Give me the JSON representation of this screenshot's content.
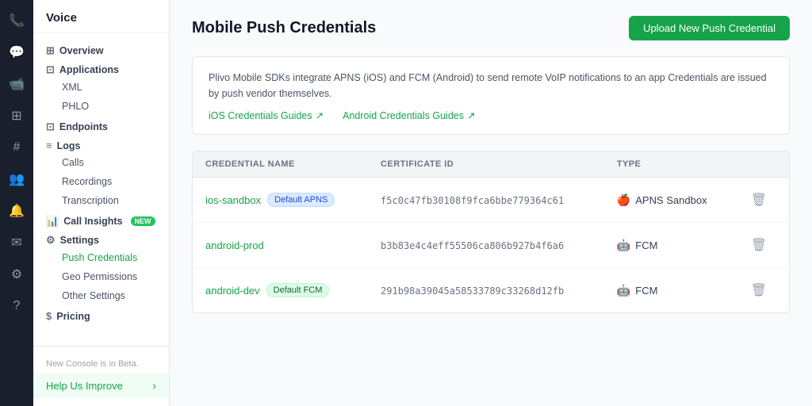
{
  "app": {
    "title": "Voice"
  },
  "icon_rail": {
    "items": [
      {
        "name": "phone-icon",
        "symbol": "📞",
        "active": true
      },
      {
        "name": "message-icon",
        "symbol": "💬",
        "active": false
      },
      {
        "name": "video-icon",
        "symbol": "📹",
        "active": false
      },
      {
        "name": "grid-icon",
        "symbol": "⋮⋮",
        "active": false
      },
      {
        "name": "hash-icon",
        "symbol": "#",
        "active": false
      },
      {
        "name": "users-icon",
        "symbol": "👥",
        "active": false
      },
      {
        "name": "bell-icon",
        "symbol": "🔔",
        "active": false
      },
      {
        "name": "letter-icon",
        "symbol": "✉",
        "active": false
      },
      {
        "name": "settings-icon",
        "symbol": "⚙",
        "active": false
      },
      {
        "name": "help-icon",
        "symbol": "?",
        "active": false
      }
    ]
  },
  "sidebar": {
    "title": "Voice",
    "nav": [
      {
        "group": "Overview",
        "icon": "⊞",
        "children": []
      },
      {
        "group": "Applications",
        "icon": "⊡",
        "children": [
          {
            "label": "XML",
            "active": false
          },
          {
            "label": "PHLO",
            "active": false
          }
        ]
      },
      {
        "group": "Endpoints",
        "icon": "⊡",
        "children": []
      },
      {
        "group": "Logs",
        "icon": "≡",
        "children": [
          {
            "label": "Calls",
            "active": false
          },
          {
            "label": "Recordings",
            "active": false
          },
          {
            "label": "Transcription",
            "active": false
          }
        ]
      },
      {
        "group": "Call Insights",
        "icon": "📊",
        "badge": "NEW",
        "children": []
      },
      {
        "group": "Settings",
        "icon": "⚙",
        "children": [
          {
            "label": "Push Credentials",
            "active": true
          },
          {
            "label": "Geo Permissions",
            "active": false
          },
          {
            "label": "Other Settings",
            "active": false
          }
        ]
      },
      {
        "group": "Pricing",
        "icon": "$",
        "children": []
      }
    ],
    "footer_note": "New Console is in Beta.",
    "help_label": "Help Us Improve"
  },
  "main": {
    "title": "Mobile Push Credentials",
    "upload_button": "Upload New Push Credential",
    "info": {
      "text": "Plivo Mobile SDKs integrate APNS (iOS) and FCM (Android) to send remote VoIP notifications to an app Credentials are issued by push vendor themselves.",
      "links": [
        {
          "label": "iOS Credentials Guides",
          "icon": "↗"
        },
        {
          "label": "Android Credentials Guides",
          "icon": "↗"
        }
      ]
    },
    "table": {
      "headers": [
        {
          "key": "name",
          "label": "Credential NAME"
        },
        {
          "key": "cert_id",
          "label": "Certificate ID"
        },
        {
          "key": "type",
          "label": "TYPE"
        }
      ],
      "rows": [
        {
          "name": "ios-sandbox",
          "badge": "Default APNS",
          "badge_type": "apns",
          "cert_id": "f5c0c47fb30108f9fca6bbe779364c61",
          "type": "APNS Sandbox",
          "type_icon": "🍎"
        },
        {
          "name": "android-prod",
          "badge": "",
          "badge_type": "",
          "cert_id": "b3b83e4c4eff55506ca806b927b4f6a6",
          "type": "FCM",
          "type_icon": "🤖"
        },
        {
          "name": "android-dev",
          "badge": "Default FCM",
          "badge_type": "fcm",
          "cert_id": "291b98a39045a58533789c33268d12fb",
          "type": "FCM",
          "type_icon": "🤖"
        }
      ]
    }
  }
}
